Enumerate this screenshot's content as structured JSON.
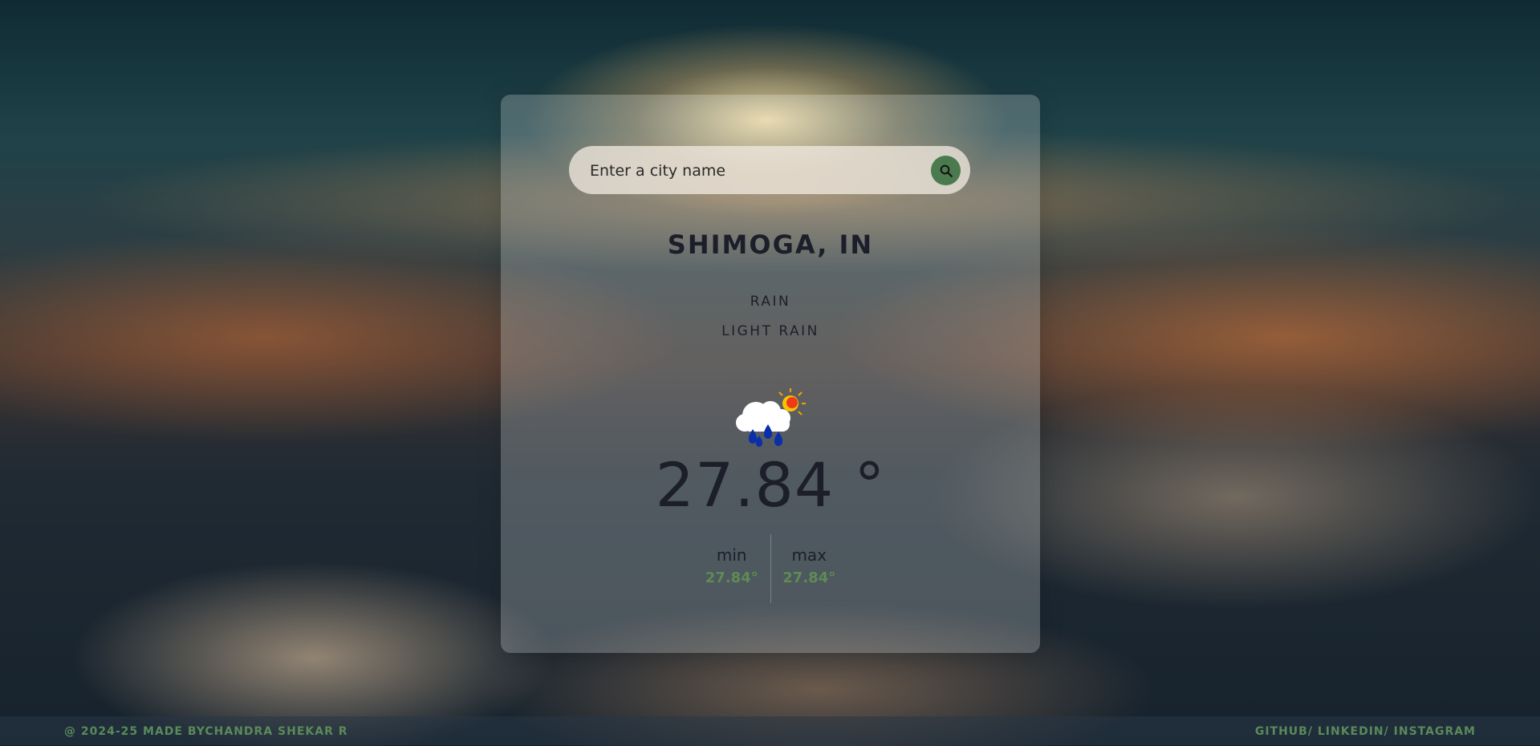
{
  "search": {
    "placeholder": "Enter a city name"
  },
  "weather": {
    "city": "SHIMOGA, IN",
    "main": "RAIN",
    "description": "LIGHT RAIN",
    "icon": "rain-sun-icon",
    "temperature": "27.84 °",
    "min_label": "min",
    "min_value": "27.84°",
    "max_label": "max",
    "max_value": "27.84°"
  },
  "footer": {
    "credit": "@ 2024-25 MADE BYCHANDRA SHEKAR R",
    "links": [
      "GITHUB/",
      "LINKEDIN/",
      "INSTAGRAM"
    ]
  },
  "colors": {
    "accent": "#4c7a4f",
    "value_green": "#5f8a55",
    "text_dark": "#1c1f2a"
  }
}
